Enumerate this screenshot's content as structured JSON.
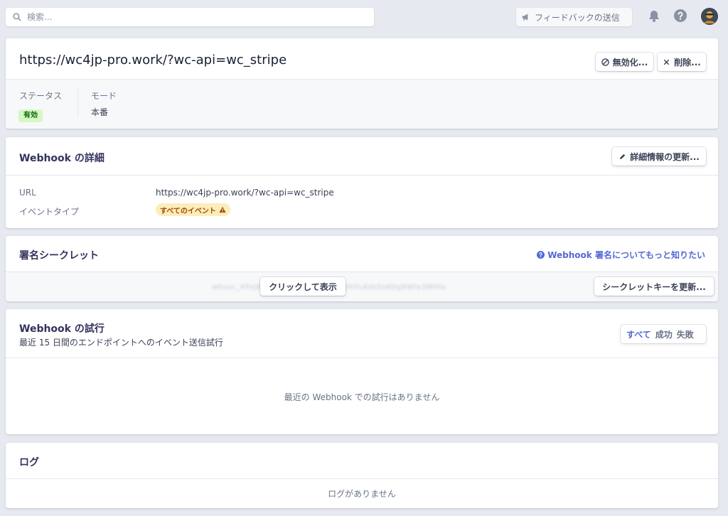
{
  "topbar": {
    "search_placeholder": "検索...",
    "feedback_label": "フィードバックの送信"
  },
  "endpoint": {
    "url": "https://wc4jp-pro.work/?wc-api=wc_stripe",
    "disable_label": "無効化...",
    "delete_label": "削除...",
    "status_label": "ステータス",
    "status_value": "有効",
    "mode_label": "モード",
    "mode_value": "本番"
  },
  "details": {
    "title": "Webhook の詳細",
    "update_label": "詳細情報の更新...",
    "url_label": "URL",
    "url_value": "https://wc4jp-pro.work/?wc-api=wc_stripe",
    "event_type_label": "イベントタイプ",
    "event_type_value": "すべてのイベント"
  },
  "secret": {
    "title": "署名シークレット",
    "help_link": "Webhook 署名についてもっと知りたい",
    "masked": "whsec_XFeJ8nAq2LmPc7TrZ9bdKw3hYu4Ve5s6Dg8Wfa3MHfo",
    "reveal_label": "クリックして表示",
    "rotate_label": "シークレットキーを更新..."
  },
  "attempts": {
    "title": "Webhook の試行",
    "subtitle": "最近 15 日間のエンドポイントへのイベント送信試行",
    "filters": [
      "すべて",
      "成功",
      "失敗"
    ],
    "empty": "最近の Webhook での試行はありません"
  },
  "logs": {
    "title": "ログ",
    "empty": "ログがありません"
  },
  "colors": {
    "accent": "#5469d4",
    "background": "#e6e9ef",
    "status_green": "#05690d",
    "warning": "#a04a07"
  }
}
